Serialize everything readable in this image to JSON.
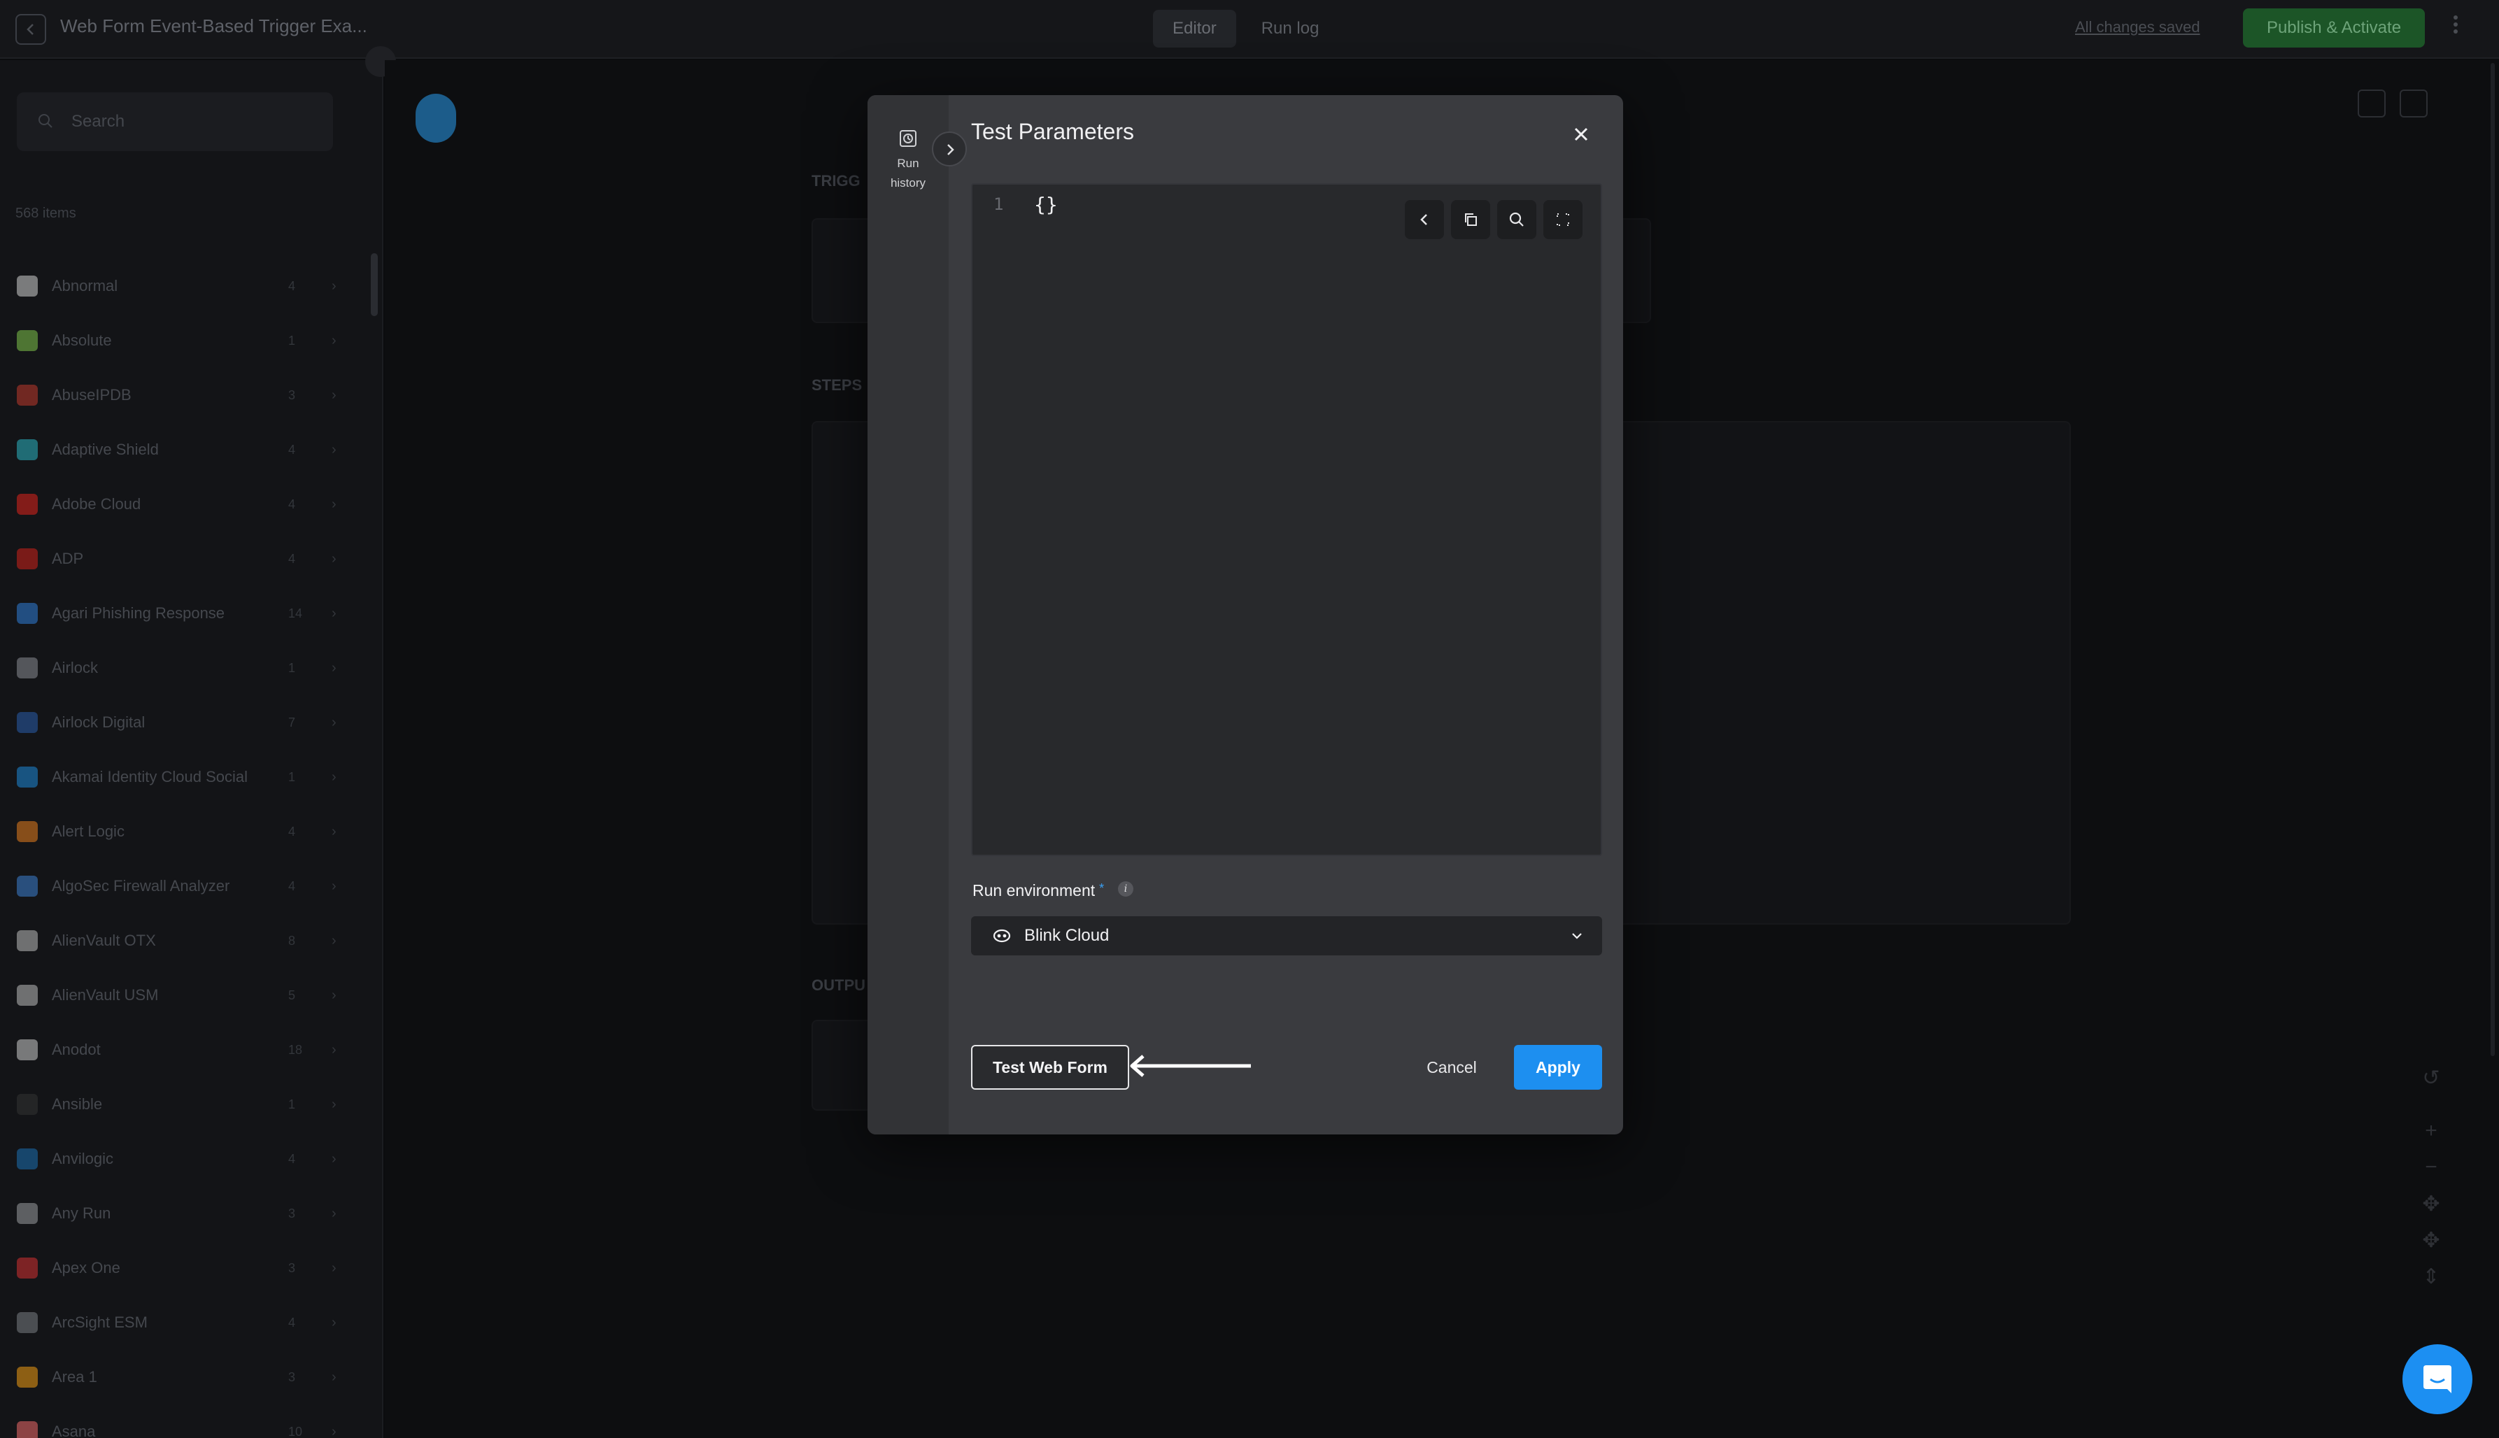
{
  "app": {
    "title": "Web Form Event-Based Trigger Exa...",
    "tabs": [
      {
        "label": "Editor",
        "active": true
      },
      {
        "label": "Run log",
        "active": false
      }
    ],
    "saved_status": "All changes saved",
    "publish_label": "Publish & Activate"
  },
  "sidebar": {
    "search_placeholder": "Search",
    "section_label": "568 items",
    "items": [
      {
        "name": "Abnormal",
        "count": "4",
        "color": "#cfcfcf"
      },
      {
        "name": "Absolute",
        "count": "1",
        "color": "#7fc44a"
      },
      {
        "name": "AbuseIPDB",
        "count": "3",
        "color": "#c0392b"
      },
      {
        "name": "Adaptive Shield",
        "count": "4",
        "color": "#2bb5c2"
      },
      {
        "name": "Adobe Cloud",
        "count": "4",
        "color": "#e0231b"
      },
      {
        "name": "ADP",
        "count": "4",
        "color": "#d0201a"
      },
      {
        "name": "Agari Phishing Response",
        "count": "14",
        "color": "#2f7ed8"
      },
      {
        "name": "Airlock",
        "count": "1",
        "color": "#8a8d93"
      },
      {
        "name": "Airlock Digital",
        "count": "7",
        "color": "#2a5cab"
      },
      {
        "name": "Akamai Identity Cloud Social",
        "count": "1",
        "color": "#1e88d8"
      },
      {
        "name": "Alert Logic",
        "count": "4",
        "color": "#e87d1e"
      },
      {
        "name": "AlgoSec Firewall Analyzer",
        "count": "4",
        "color": "#3d7fd1"
      },
      {
        "name": "AlienVault OTX",
        "count": "8",
        "color": "#bbbbbb"
      },
      {
        "name": "AlienVault USM",
        "count": "5",
        "color": "#bbbbbb"
      },
      {
        "name": "Anodot",
        "count": "18",
        "color": "#cccccc"
      },
      {
        "name": "Ansible",
        "count": "1",
        "color": "#333333"
      },
      {
        "name": "Anvilogic",
        "count": "4",
        "color": "#1b6fb3"
      },
      {
        "name": "Any Run",
        "count": "3",
        "color": "#9a9ca1"
      },
      {
        "name": "Apex One",
        "count": "3",
        "color": "#d63031"
      },
      {
        "name": "ArcSight ESM",
        "count": "4",
        "color": "#7a7d83"
      },
      {
        "name": "Area 1",
        "count": "3",
        "color": "#f39c12"
      },
      {
        "name": "Asana",
        "count": "10",
        "color": "#f06a6a"
      }
    ]
  },
  "canvas": {
    "trigger_label": "TRIGG",
    "steps_label": "STEPS",
    "output_label": "OUTPU"
  },
  "modal": {
    "title": "Test Parameters",
    "side_label_line1": "Run",
    "side_label_line2": "history",
    "editor": {
      "line_number": "1",
      "content": "{}"
    },
    "run_env": {
      "label": "Run environment",
      "required_mark": "*",
      "info_glyph": "i",
      "value": "Blink Cloud"
    },
    "buttons": {
      "test": "Test Web Form",
      "cancel": "Cancel",
      "apply": "Apply"
    }
  },
  "colors": {
    "accent": "#1d8ff0",
    "modal_bg": "#3a3b3f",
    "editor_bg": "#28292c"
  }
}
